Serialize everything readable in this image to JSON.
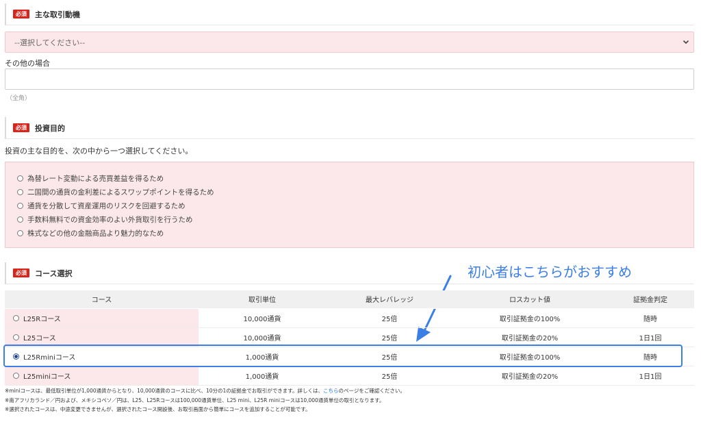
{
  "section1": {
    "badge": "必須",
    "title": "主な取引動機"
  },
  "select": {
    "value": "--選択してください--"
  },
  "other": {
    "label": "その他の場合",
    "hint": "（全角）",
    "value": ""
  },
  "section2": {
    "badge": "必須",
    "title": "投資目的"
  },
  "purpose": {
    "description": "投資の主な目的を、次の中から一つ選択してください。",
    "options": [
      "為替レート変動による売買差益を得るため",
      "二国間の通貨の金利差によるスワップポイントを得るため",
      "通貨を分散して資産運用のリスクを回避するため",
      "手数料無料での資金効率のよい外貨取引を行うため",
      "株式などの他の金融商品より魅力的なため"
    ]
  },
  "section3": {
    "badge": "必須",
    "title": "コース選択"
  },
  "annotation": "初心者はこちらがおすすめ",
  "course_table": {
    "headers": [
      "コース",
      "取引単位",
      "最大レバレッジ",
      "ロスカット値",
      "証拠金判定"
    ],
    "rows": [
      {
        "name": "L25Rコース",
        "unit": "10,000通貨",
        "leverage": "25倍",
        "losscut": "取引証拠金の100%",
        "judge": "随時",
        "selected": false
      },
      {
        "name": "L25コース",
        "unit": "10,000通貨",
        "leverage": "25倍",
        "losscut": "取引証拠金の20%",
        "judge": "1日1回",
        "selected": false
      },
      {
        "name": "L25Rminiコース",
        "unit": "1,000通貨",
        "leverage": "25倍",
        "losscut": "取引証拠金の100%",
        "judge": "随時",
        "selected": true
      },
      {
        "name": "L25miniコース",
        "unit": "1,000通貨",
        "leverage": "25倍",
        "losscut": "取引証拠金の20%",
        "judge": "1日1回",
        "selected": false
      }
    ]
  },
  "notes": {
    "line1_before": "※miniコースは、最低取引単位が1,000通貨からとなり、10,000通貨のコースに比べ、10分の1の証拠金でお取引ができます。詳しくは、",
    "line1_link": "こちら",
    "line1_after": "のページをご確認ください。",
    "line2": "※南アフリカランド／円および、メキシコペソ／円は、L25、L25Rコースは100,000通貨単位、L25 mini、L25R miniコースは10,000通貨単位の取引となります。",
    "line3": "※選択されたコースは、中途変更できませんが、選択されたコース開設後、お取引画面から簡単にコースを追加することが可能です。"
  },
  "colors": {
    "required_badge": "#d9241b",
    "pink_bg": "#fce8ea",
    "annotation_blue": "#3a7ee6",
    "link": "#1a6fd0"
  }
}
